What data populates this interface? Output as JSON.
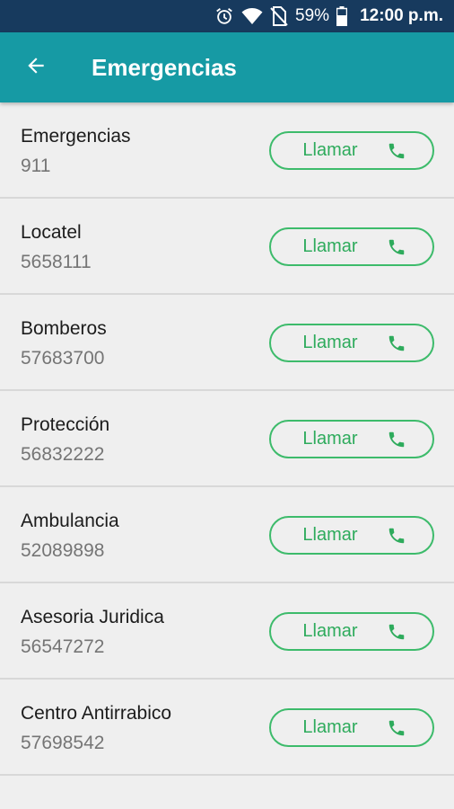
{
  "status": {
    "battery_percent": "59%",
    "time": "12:00 p.m.",
    "icons": [
      "alarm-icon",
      "wifi-icon",
      "no-sim-icon",
      "battery-icon"
    ]
  },
  "appbar": {
    "title": "Emergencias",
    "back_icon": "arrow-back-icon"
  },
  "colors": {
    "status_bar": "#173a5e",
    "app_bar": "#169aa4",
    "accent_green": "#2eab5c",
    "background": "#efefef"
  },
  "contacts": [
    {
      "name": "Emergencias",
      "number": "911",
      "button_label": "Llamar"
    },
    {
      "name": "Locatel",
      "number": "5658111",
      "button_label": "Llamar"
    },
    {
      "name": "Bomberos",
      "number": "57683700",
      "button_label": "Llamar"
    },
    {
      "name": "Protección",
      "number": "56832222",
      "button_label": "Llamar"
    },
    {
      "name": "Ambulancia",
      "number": "52089898",
      "button_label": "Llamar"
    },
    {
      "name": "Asesoria Juridica",
      "number": "56547272",
      "button_label": "Llamar"
    },
    {
      "name": "Centro Antirrabico",
      "number": "57698542",
      "button_label": "Llamar"
    }
  ]
}
